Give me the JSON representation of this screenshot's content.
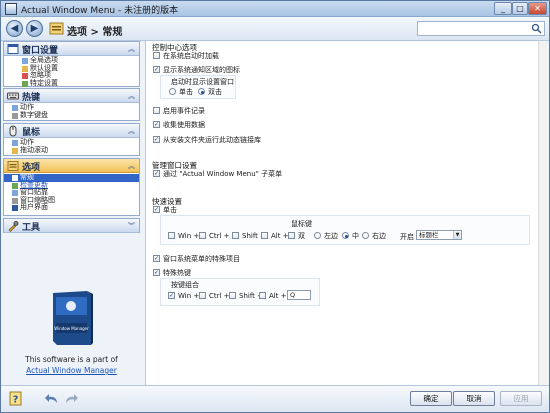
{
  "window": {
    "title": "Actual Window Menu - 未注册的版本",
    "close_glyph": "✕",
    "max_glyph": "□",
    "min_glyph": "_"
  },
  "toolbar": {
    "breadcrumb": "选项 > 常规",
    "back_glyph": "◀",
    "forward_glyph": "▶"
  },
  "sidebar": {
    "sections": [
      {
        "title": "窗口设置",
        "items": [
          {
            "label": "全局选项",
            "sub": true
          },
          {
            "label": "默认设置",
            "sub": true
          },
          {
            "label": "忽略项",
            "sub": true
          },
          {
            "label": "特定设置",
            "sub": true
          }
        ]
      },
      {
        "title": "热键",
        "items": [
          {
            "label": "动作"
          },
          {
            "label": "数字键盘"
          }
        ]
      },
      {
        "title": "鼠标",
        "items": [
          {
            "label": "动作"
          },
          {
            "label": "拖动滚动"
          }
        ]
      },
      {
        "title": "选项",
        "active": true,
        "items": [
          {
            "label": "常规",
            "selected": true
          },
          {
            "label": "检查更新",
            "link": true
          },
          {
            "label": "窗口贴靠"
          },
          {
            "label": "窗口缩略图"
          },
          {
            "label": "用户界面"
          }
        ]
      },
      {
        "title": "工具",
        "items": []
      }
    ],
    "promo": {
      "line1": "This software is a part of",
      "line2": "Actual Window Manager",
      "box_brand": "Window Manager"
    }
  },
  "content": {
    "control_center": {
      "heading": "控制中心选项",
      "load_on_startup": "在系统启动时加载",
      "show_tray_icon": "显示系统通知区域的图标",
      "show_settings_window": "启动时显示设置窗口",
      "single_click": "单击",
      "double_click": "双击",
      "enable_log": "启用事件记录",
      "collect_usage": "收集使用数据",
      "run_from_install": "从安装文件夹运行此动态链接库"
    },
    "window_mgmt": {
      "heading": "管理窗口设置",
      "via_submenu": "通过 \"Actual Window Menu\" 子菜单"
    },
    "quick_settings": {
      "heading": "快速设置",
      "single_click": "单击",
      "mouse_button_label": "鼠标键",
      "win": "Win +",
      "ctrl": "Ctrl +",
      "shift": "Shift +",
      "alt": "Alt +",
      "double": "双",
      "left": "左边",
      "middle": "中",
      "right": "右边",
      "open_label": "开启",
      "open_value": "标题栏",
      "system_menu_items": "窗口系统菜单的特殊项目",
      "special_hotkey": "特殊热键",
      "hotkey_combo_label": "按键组合",
      "hotkey_key": "Q"
    }
  },
  "bottom": {
    "ok": "确定",
    "cancel": "取消",
    "apply": "应用"
  },
  "colors": {
    "accent": "#3166c7",
    "active_section": "#f3c15a",
    "link": "#1c52b8"
  }
}
